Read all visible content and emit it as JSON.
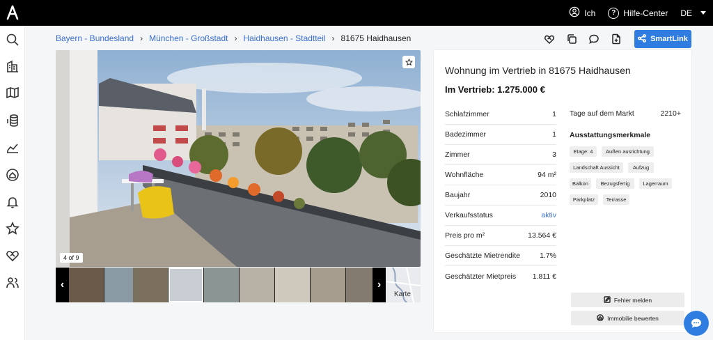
{
  "topbar": {
    "logo_icon": "logo-a-icon",
    "user_label": "Ich",
    "help_label": "Hilfe-Center",
    "help_icon_glyph": "?",
    "language": "DE"
  },
  "sidebar": {
    "items": [
      {
        "name": "search-icon"
      },
      {
        "name": "buildings-icon"
      },
      {
        "name": "map-icon"
      },
      {
        "name": "money-icon"
      },
      {
        "name": "chart-icon"
      },
      {
        "name": "home-search-icon"
      },
      {
        "name": "bell-icon"
      },
      {
        "name": "star-icon"
      },
      {
        "name": "heart-handshake-icon"
      },
      {
        "name": "users-icon"
      }
    ]
  },
  "breadcrumb": {
    "items": [
      "Bayern - Bundesland",
      "München - Großstadt",
      "Haidhausen - Stadtteil"
    ],
    "current": "81675 Haidhausen",
    "separator": "›"
  },
  "actions": {
    "smartlink_label": "SmartLink",
    "icons": [
      "heart-handshake-icon",
      "copy-icon",
      "comment-icon",
      "add-file-icon"
    ]
  },
  "gallery": {
    "counter": "4 of 9",
    "prev_glyph": "‹",
    "next_glyph": "›",
    "map_label": "Karte",
    "thumb_colors": [
      "#6b5a4a",
      "#8a9aa4",
      "#7b6f5e",
      "#c7cdd2",
      "#8b9694",
      "#b7b1a5",
      "#cfc8bc",
      "#a79d8e",
      "#847b70"
    ]
  },
  "listing": {
    "title": "Wohnung im Vertrieb in 81675 Haidhausen",
    "price": "Im Vertrieb: 1.275.000 €",
    "facts": [
      {
        "label": "Schlafzimmer",
        "value": "1"
      },
      {
        "label": "Badezimmer",
        "value": "1"
      },
      {
        "label": "Zimmer",
        "value": "3"
      },
      {
        "label": "Wohnfläche",
        "value": "94 m²"
      },
      {
        "label": "Baujahr",
        "value": "2010"
      },
      {
        "label": "Verkaufsstatus",
        "value": "aktiv"
      },
      {
        "label": "Preis pro m²",
        "value": "13.564 €"
      },
      {
        "label": "Geschätzte Mietrendite",
        "value": "1.7%"
      },
      {
        "label": "Geschätzter Mietpreis",
        "value": "1.811 €"
      }
    ],
    "days_label": "Tage auf dem Markt",
    "days_value": "2210+",
    "features_title": "Ausstattungsmerkmale",
    "features": [
      "Etage: 4",
      "Außen ausrichtung",
      "Landschaft Aussicht",
      "Aufzug",
      "Balkon",
      "Bezugsfertig",
      "Lagerraum",
      "Parkplatz",
      "Terrasse"
    ],
    "report_label": "Fehler melden",
    "rate_label": "Immobilie bewerten"
  },
  "colors": {
    "accent": "#2f7de1",
    "link": "#3a6fd8",
    "topbar": "#000000"
  }
}
